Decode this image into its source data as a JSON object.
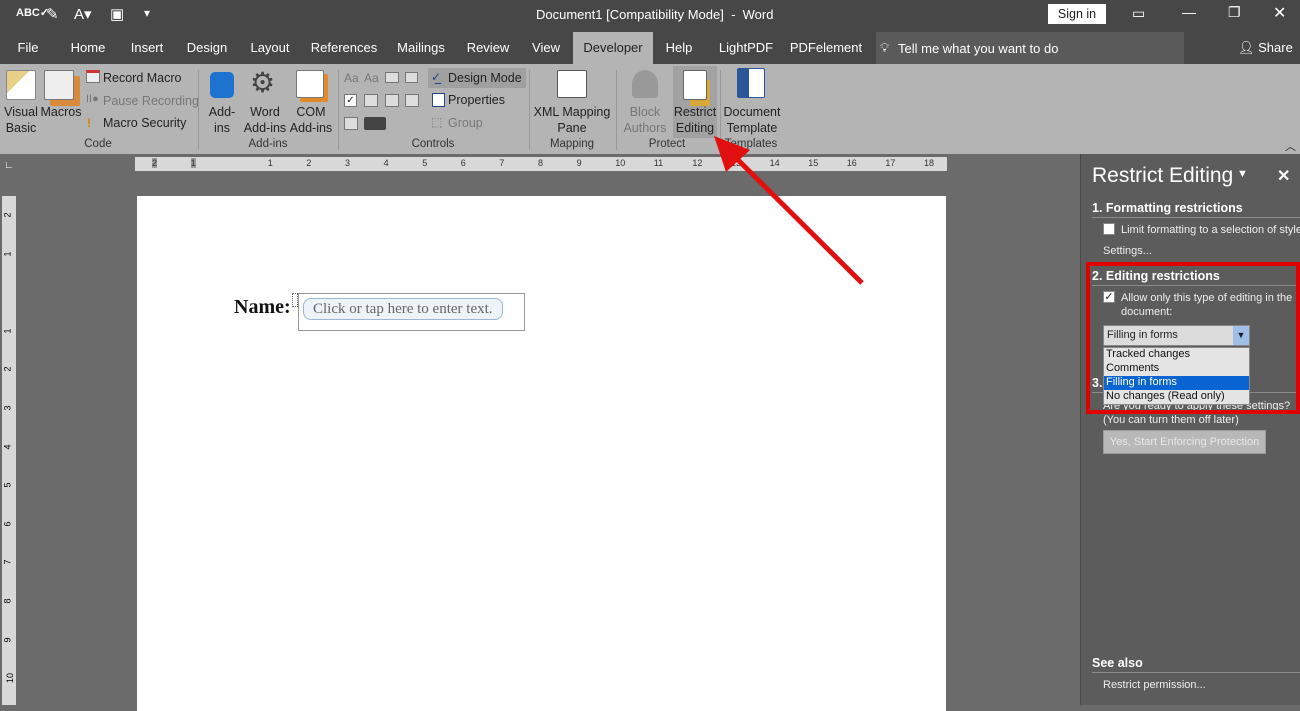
{
  "titlebar": {
    "title": "Document1 [Compatibility Mode]  -  Word",
    "sign_in": "Sign in"
  },
  "tabs": [
    "File",
    "Home",
    "Insert",
    "Design",
    "Layout",
    "References",
    "Mailings",
    "Review",
    "View",
    "Developer",
    "Help",
    "LightPDF",
    "PDFelement"
  ],
  "active_tab": "Developer",
  "tell_me": "Tell me what you want to do",
  "share": "Share",
  "ribbon": {
    "code": {
      "visual_basic": "Visual Basic",
      "macros": "Macros",
      "record_macro": "Record Macro",
      "pause_recording": "Pause Recording",
      "macro_security": "Macro Security",
      "label": "Code"
    },
    "addins": {
      "addins": "Add-ins",
      "word_addins": "Word Add-ins",
      "com_addins": "COM Add-ins",
      "label": "Add-ins"
    },
    "controls": {
      "design_mode": "Design Mode",
      "properties": "Properties",
      "group": "Group",
      "label": "Controls"
    },
    "mapping": {
      "xml_pane": "XML Mapping Pane",
      "label": "Mapping"
    },
    "protect": {
      "block_authors": "Block Authors",
      "restrict_editing": "Restrict Editing",
      "label": "Protect"
    },
    "templates": {
      "document_template": "Document Template",
      "label": "Templates"
    }
  },
  "ruler_numbers": [
    "2",
    "1",
    "",
    "1",
    "2",
    "3",
    "4",
    "5",
    "6",
    "7",
    "8",
    "9",
    "10",
    "11",
    "12",
    "13",
    "14",
    "15",
    "16",
    "17",
    "18"
  ],
  "vruler_numbers": [
    "2",
    "1",
    "",
    "1",
    "2",
    "3",
    "4",
    "5",
    "6",
    "7",
    "8",
    "9",
    "10"
  ],
  "document": {
    "label": "Name:",
    "placeholder": "Click or tap here to enter text."
  },
  "pane": {
    "title": "Restrict Editing",
    "s1": "1. Formatting restrictions",
    "limit": "Limit formatting to a selection of styles",
    "settings": "Settings...",
    "s2": "2. Editing restrictions",
    "allow": "Allow only this type of editing in the document:",
    "allow_checked": true,
    "selected": "Filling in forms",
    "options": [
      "Tracked changes",
      "Comments",
      "Filling in forms",
      "No changes (Read only)"
    ],
    "s3": "3.",
    "ready": "Are you ready to apply these settings? (You can turn them off later)",
    "enforce": "Yes, Start Enforcing Protection",
    "see_also": "See also",
    "restrict_permission": "Restrict permission..."
  },
  "colors": {
    "highlight": "#e00000",
    "selection": "#0a64d2",
    "arrow": "#e01010"
  }
}
